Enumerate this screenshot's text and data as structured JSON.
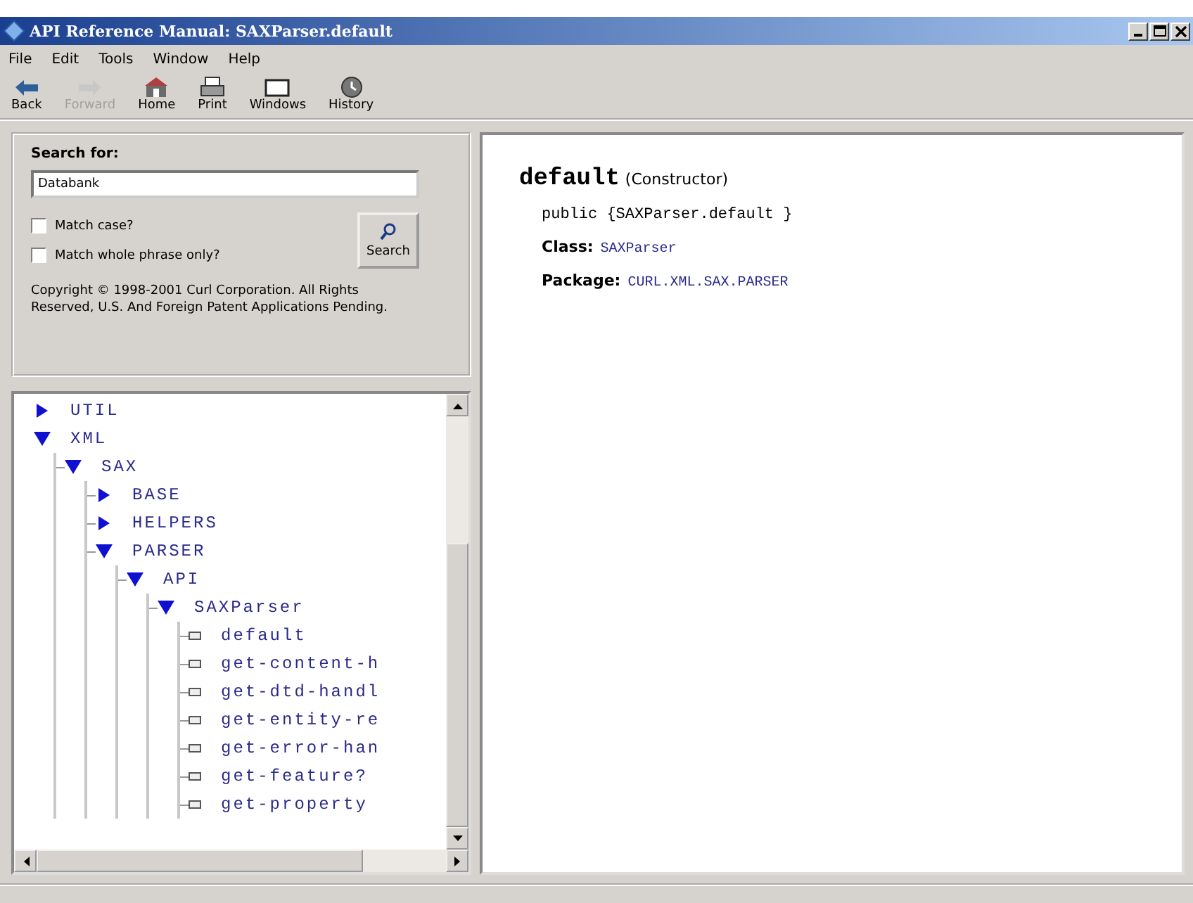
{
  "window": {
    "title": "API Reference Manual: SAXParser.default"
  },
  "menu": [
    {
      "label": "File"
    },
    {
      "label": "Edit"
    },
    {
      "label": "Tools"
    },
    {
      "label": "Window"
    },
    {
      "label": "Help"
    }
  ],
  "toolbar": [
    {
      "label": "Back",
      "kind": "back",
      "disabled": false
    },
    {
      "label": "Forward",
      "kind": "forward",
      "disabled": true
    },
    {
      "label": "Home",
      "kind": "home",
      "disabled": false
    },
    {
      "label": "Print",
      "kind": "print",
      "disabled": false
    },
    {
      "label": "Windows",
      "kind": "windows",
      "disabled": false
    },
    {
      "label": "History",
      "kind": "history",
      "disabled": false
    }
  ],
  "search": {
    "heading": "Search for:",
    "value": "Databank",
    "button": "Search",
    "options": [
      {
        "label": "Match case?",
        "checked": false
      },
      {
        "label": "Match whole phrase only?",
        "checked": false
      }
    ],
    "copyright": "Copyright © 1998-2001 Curl Corporation. All Rights Reserved, U.S. And Foreign Patent Applications Pending."
  },
  "tree": [
    {
      "label": "UTIL",
      "expanded": false
    },
    {
      "label": "XML",
      "expanded": true,
      "children": [
        {
          "label": "SAX",
          "expanded": true,
          "children": [
            {
              "label": "BASE",
              "expanded": false
            },
            {
              "label": "HELPERS",
              "expanded": false
            },
            {
              "label": "PARSER",
              "expanded": true,
              "children": [
                {
                  "label": "API",
                  "expanded": true,
                  "children": [
                    {
                      "label": "SAXParser",
                      "expanded": true,
                      "children": [
                        {
                          "label": "default",
                          "kind": "leaf"
                        },
                        {
                          "label": "get-content-h",
                          "kind": "leaf"
                        },
                        {
                          "label": "get-dtd-handl",
                          "kind": "leaf"
                        },
                        {
                          "label": "get-entity-re",
                          "kind": "leaf"
                        },
                        {
                          "label": "get-error-han",
                          "kind": "leaf"
                        },
                        {
                          "label": "get-feature?",
                          "kind": "leaf"
                        },
                        {
                          "label": "get-property",
                          "kind": "leaf"
                        }
                      ]
                    }
                  ]
                }
              ]
            }
          ]
        }
      ]
    }
  ],
  "content": {
    "name": "default",
    "kind": "(Constructor)",
    "signature": "public {SAXParser.default }",
    "fields": [
      {
        "label": "Class:",
        "value": "SAXParser"
      },
      {
        "label": "Package:",
        "value": "CURL.XML.SAX.PARSER"
      }
    ]
  }
}
